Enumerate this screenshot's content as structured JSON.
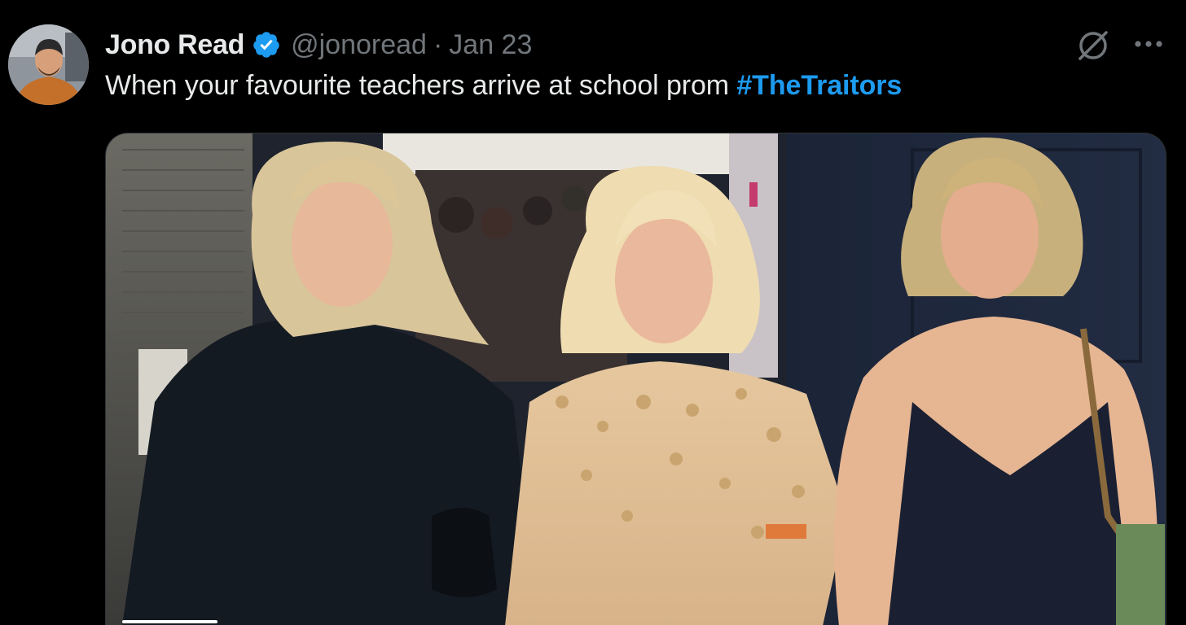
{
  "author": {
    "display_name": "Jono Read",
    "handle": "@jonoread",
    "separator": "·",
    "date": "Jan 23",
    "verified": true,
    "avatar_icon": "profile-photo"
  },
  "tweet": {
    "text": "When your favourite teachers arrive at school prom ",
    "hashtag": "#TheTraitors"
  },
  "actions": {
    "grok_icon": "grok-slash-icon",
    "more_icon": "more-dots-icon"
  },
  "media": {
    "type": "video",
    "progress": 0.09,
    "alt": "three women walking arm in arm"
  },
  "colors": {
    "background": "#000000",
    "text": "#e7e9ea",
    "secondary": "#71767b",
    "accent": "#1d9bf0"
  }
}
